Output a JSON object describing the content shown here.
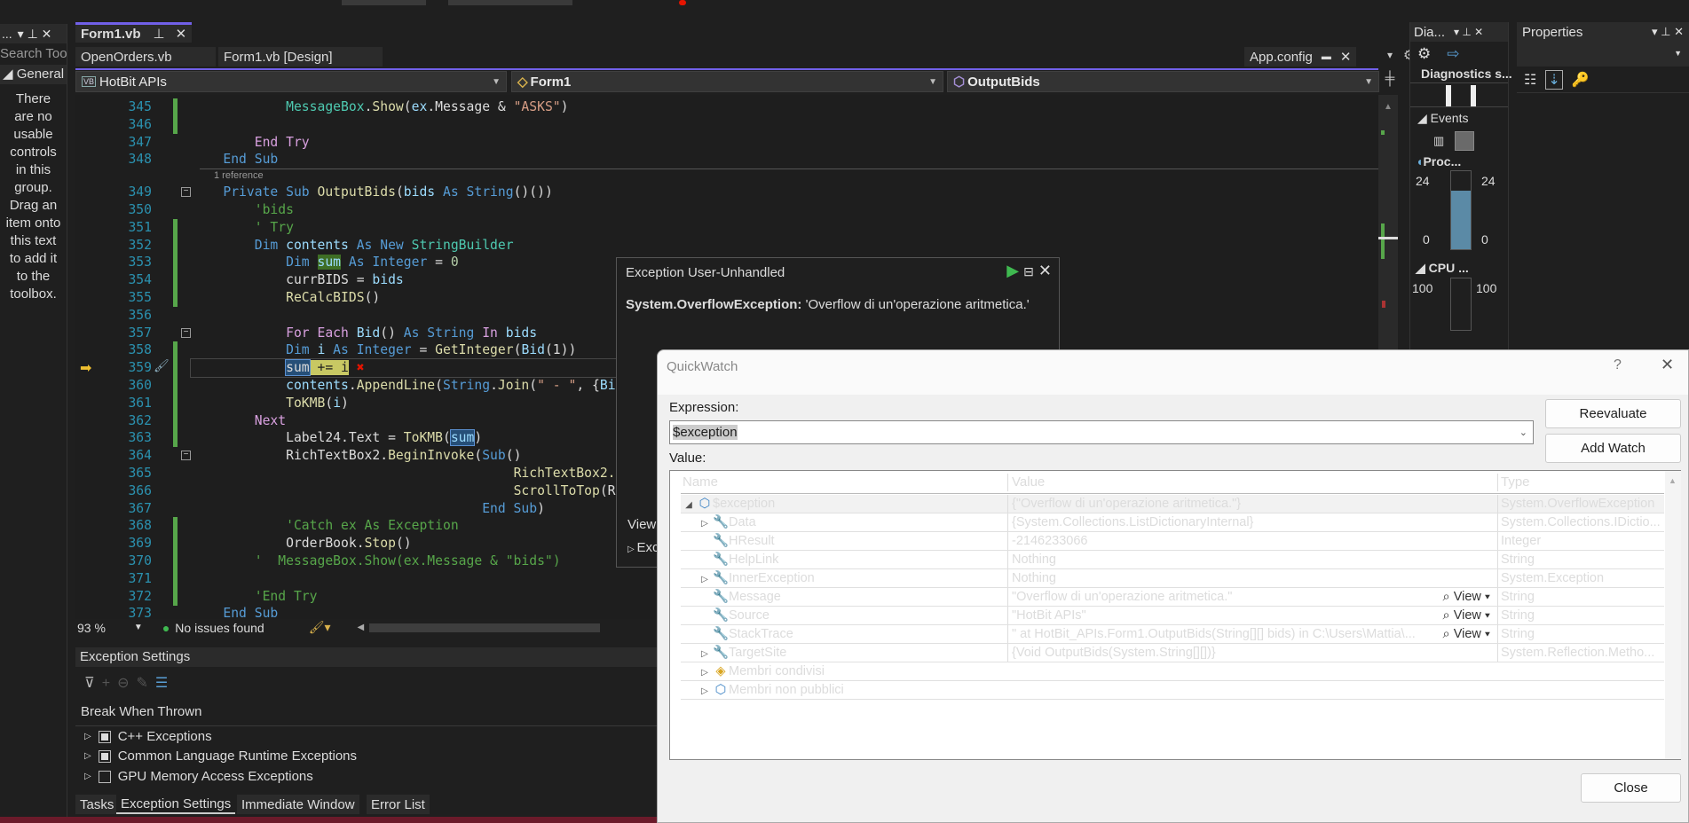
{
  "toolbox": {
    "header_dots": "...",
    "search_placeholder": "Search Tool",
    "group": "General",
    "empty_message": "There are no usable controls in this group. Drag an item onto this text to add it to the toolbox."
  },
  "editor": {
    "active_tab": "Form1.vb",
    "preview_tabs": [
      "OpenOrders.vb",
      "Form1.vb [Design]"
    ],
    "right_tab": "App.config",
    "nav": {
      "project": "HotBit APIs",
      "class": "Form1",
      "member": "OutputBids"
    },
    "reference_hint": "1 reference",
    "current_line": 359,
    "lines": [
      {
        "n": 345,
        "t": [
          [
            "            ",
            "p"
          ],
          [
            "MessageBox",
            "t"
          ],
          [
            ".",
            "p"
          ],
          [
            "Show",
            "m"
          ],
          [
            "(",
            "p"
          ],
          [
            "ex",
            "v"
          ],
          [
            ".Message & ",
            "p"
          ],
          [
            "\"ASKS\"",
            "s"
          ],
          [
            ")",
            "p"
          ]
        ]
      },
      {
        "n": 346,
        "t": []
      },
      {
        "n": 347,
        "t": [
          [
            "        ",
            "p"
          ],
          [
            "End Try",
            "c"
          ]
        ]
      },
      {
        "n": 348,
        "t": [
          [
            "    ",
            "p"
          ],
          [
            "End Sub",
            "k"
          ]
        ]
      },
      {
        "n": 349,
        "t": [
          [
            "    ",
            "p"
          ],
          [
            "Private Sub ",
            "k"
          ],
          [
            "OutputBids",
            "m"
          ],
          [
            "(",
            "p"
          ],
          [
            "bids",
            "v"
          ],
          [
            " As ",
            "k"
          ],
          [
            "String",
            "k"
          ],
          [
            "()())",
            "p"
          ]
        ]
      },
      {
        "n": 350,
        "t": [
          [
            "        ",
            "p"
          ],
          [
            "'bids",
            "cm"
          ]
        ]
      },
      {
        "n": 351,
        "t": [
          [
            "        ",
            "p"
          ],
          [
            "' Try",
            "cm"
          ]
        ]
      },
      {
        "n": 352,
        "t": [
          [
            "        ",
            "p"
          ],
          [
            "Dim ",
            "k"
          ],
          [
            "contents",
            "v"
          ],
          [
            " As New ",
            "k"
          ],
          [
            "StringBuilder",
            "t"
          ]
        ]
      },
      {
        "n": 353,
        "t": [
          [
            "            ",
            "p"
          ],
          [
            "Dim ",
            "k"
          ],
          [
            "sum",
            "v hl-green"
          ],
          [
            " As Integer ",
            "k"
          ],
          [
            "= ",
            "p"
          ],
          [
            "0",
            "n"
          ]
        ]
      },
      {
        "n": 354,
        "t": [
          [
            "            ",
            "p"
          ],
          [
            "currBIDS",
            "p"
          ],
          [
            " = ",
            "p"
          ],
          [
            "bids",
            "v"
          ]
        ]
      },
      {
        "n": 355,
        "t": [
          [
            "            ",
            "p"
          ],
          [
            "ReCalcBIDS",
            "m"
          ],
          [
            "()",
            "p"
          ]
        ]
      },
      {
        "n": 356,
        "t": []
      },
      {
        "n": 357,
        "t": [
          [
            "            ",
            "p"
          ],
          [
            "For Each ",
            "c"
          ],
          [
            "Bid",
            "v"
          ],
          [
            "() ",
            "p"
          ],
          [
            "As String ",
            "k"
          ],
          [
            "In ",
            "c"
          ],
          [
            "bids",
            "v"
          ]
        ]
      },
      {
        "n": 358,
        "t": [
          [
            "            ",
            "p"
          ],
          [
            "Dim ",
            "k"
          ],
          [
            "i",
            "v"
          ],
          [
            " As Integer ",
            "k"
          ],
          [
            "= ",
            "p"
          ],
          [
            "GetInteger",
            "m"
          ],
          [
            "(",
            "p"
          ],
          [
            "Bid",
            "v"
          ],
          [
            "(1))",
            "p"
          ]
        ]
      },
      {
        "n": 359,
        "t": [
          [
            "            ",
            "p"
          ],
          [
            "sum",
            "hl-blue p"
          ],
          [
            " += i",
            "hl-yellow"
          ]
        ]
      },
      {
        "n": 360,
        "t": [
          [
            "            ",
            "p"
          ],
          [
            "contents",
            "v"
          ],
          [
            ".",
            "p"
          ],
          [
            "AppendLine",
            "m"
          ],
          [
            "(",
            "p"
          ],
          [
            "String",
            "k"
          ],
          [
            ".",
            "p"
          ],
          [
            "Join",
            "m"
          ],
          [
            "(",
            "p"
          ],
          [
            "\" - \"",
            "s"
          ],
          [
            ", {",
            "p"
          ],
          [
            "Bi",
            "v"
          ]
        ]
      },
      {
        "n": 361,
        "t": [
          [
            "            ",
            "p"
          ],
          [
            "ToKMB",
            "m"
          ],
          [
            "(",
            "p"
          ],
          [
            "i",
            "v"
          ],
          [
            ")",
            "p"
          ]
        ]
      },
      {
        "n": 362,
        "t": [
          [
            "        ",
            "p"
          ],
          [
            "Next",
            "c"
          ]
        ]
      },
      {
        "n": 363,
        "t": [
          [
            "            ",
            "p"
          ],
          [
            "Label24",
            "p"
          ],
          [
            ".Text = ",
            "p"
          ],
          [
            "ToKMB",
            "m"
          ],
          [
            "(",
            "p"
          ],
          [
            "sum",
            "v hl-blue"
          ],
          [
            ")",
            "p"
          ]
        ]
      },
      {
        "n": 364,
        "t": [
          [
            "            ",
            "p"
          ],
          [
            "RichTextBox2",
            "p"
          ],
          [
            ".",
            "p"
          ],
          [
            "BeginInvoke",
            "m"
          ],
          [
            "(",
            "p"
          ],
          [
            "Sub",
            "k"
          ],
          [
            "()",
            "p"
          ]
        ]
      },
      {
        "n": 365,
        "t": [
          [
            "                                         ",
            "p"
          ],
          [
            "RichTextBox2.",
            "m"
          ]
        ]
      },
      {
        "n": 366,
        "t": [
          [
            "                                         ",
            "p"
          ],
          [
            "ScrollToTop",
            "m"
          ],
          [
            "(R",
            "p"
          ]
        ]
      },
      {
        "n": 367,
        "t": [
          [
            "                                     ",
            "p"
          ],
          [
            "End Sub",
            "k"
          ],
          [
            ")",
            "p"
          ]
        ]
      },
      {
        "n": 368,
        "t": [
          [
            "            ",
            "p"
          ],
          [
            "'Catch ex As Exception",
            "cm"
          ]
        ]
      },
      {
        "n": 369,
        "t": [
          [
            "            ",
            "p"
          ],
          [
            "OrderBook",
            "p"
          ],
          [
            ".",
            "p"
          ],
          [
            "Stop",
            "m"
          ],
          [
            "()",
            "p"
          ]
        ]
      },
      {
        "n": 370,
        "t": [
          [
            "        ",
            "p"
          ],
          [
            "'  MessageBox.Show(ex.Message & \"bids\")",
            "cm"
          ]
        ]
      },
      {
        "n": 371,
        "t": []
      },
      {
        "n": 372,
        "t": [
          [
            "        ",
            "p"
          ],
          [
            "'End Try",
            "cm"
          ]
        ]
      },
      {
        "n": 373,
        "t": [
          [
            "    ",
            "p"
          ],
          [
            "End Sub",
            "k"
          ]
        ]
      }
    ]
  },
  "status": {
    "zoom": "93 %",
    "issues": "No issues found"
  },
  "exception_settings": {
    "title": "Exception Settings",
    "section": "Break When Thrown",
    "items": [
      "C++ Exceptions",
      "Common Language Runtime Exceptions",
      "GPU Memory Access Exceptions"
    ]
  },
  "bottom_tabs": [
    "Tasks",
    "Exception Settings",
    "Immediate Window",
    "Error List"
  ],
  "exception_popup": {
    "title": "Exception User-Unhandled",
    "type": "System.OverflowException:",
    "message": "'Overflow di un'operazione aritmetica.'",
    "view_label": "View",
    "exc_label": "Exc"
  },
  "quickwatch": {
    "title": "QuickWatch",
    "help": "?",
    "expression_label": "Expression:",
    "expression": "$exception",
    "value_label": "Value:",
    "reevaluate": "Reevaluate",
    "add_watch": "Add Watch",
    "close": "Close",
    "columns": [
      "Name",
      "Value",
      "Type"
    ],
    "view_label": "View",
    "rows": [
      {
        "name": "$exception",
        "value": "{\"Overflow di un'operazione aritmetica.\"}",
        "type": "System.OverflowException",
        "expand": "open",
        "icon": "object",
        "level": 0
      },
      {
        "name": "Data",
        "value": "{System.Collections.ListDictionaryInternal}",
        "type": "System.Collections.IDictio...",
        "expand": "closed",
        "icon": "wrench",
        "level": 1
      },
      {
        "name": "HResult",
        "value": "-2146233066",
        "type": "Integer",
        "expand": "",
        "icon": "wrench",
        "level": 1
      },
      {
        "name": "HelpLink",
        "value": "Nothing",
        "type": "String",
        "expand": "",
        "icon": "wrench",
        "level": 1
      },
      {
        "name": "InnerException",
        "value": "Nothing",
        "type": "System.Exception",
        "expand": "closed",
        "icon": "wrench",
        "level": 1
      },
      {
        "name": "Message",
        "value": "\"Overflow di un'operazione aritmetica.\"",
        "type": "String",
        "expand": "",
        "icon": "wrench",
        "level": 1,
        "view": true
      },
      {
        "name": "Source",
        "value": "\"HotBit APIs\"",
        "type": "String",
        "expand": "",
        "icon": "wrench",
        "level": 1,
        "view": true
      },
      {
        "name": "StackTrace",
        "value": "\"   at HotBit_APIs.Form1.OutputBids(String[][] bids) in C:\\Users\\Mattia\\...",
        "type": "String",
        "expand": "",
        "icon": "wrench",
        "level": 1,
        "view": true
      },
      {
        "name": "TargetSite",
        "value": "{Void OutputBids(System.String[][])}",
        "type": "System.Reflection.Metho...",
        "expand": "closed",
        "icon": "wrench",
        "level": 1
      },
      {
        "name": "Membri condivisi",
        "value": "",
        "type": "",
        "expand": "closed",
        "icon": "shared",
        "level": 1
      },
      {
        "name": "Membri non pubblici",
        "value": "",
        "type": "",
        "expand": "closed",
        "icon": "object",
        "level": 1
      }
    ]
  },
  "diagnostics": {
    "title": "Dia...",
    "session": "Diagnostics s...",
    "events": "Events",
    "process": "Proc...",
    "mem_max": "24",
    "mem_min": "0",
    "cpu": "CPU ...",
    "cpu_max": "100"
  },
  "properties": {
    "title": "Properties"
  },
  "colors": {
    "accent": "#7160e8",
    "error": "#e51400",
    "change_bar": "#57a64a"
  }
}
